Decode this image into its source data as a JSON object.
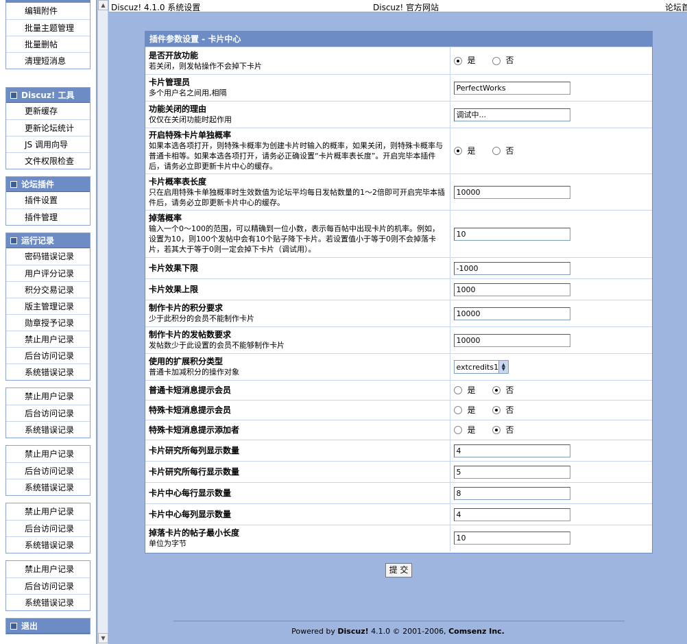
{
  "topbar": {
    "left": "Discuz! 4.1.0 系统设置",
    "center": "Discuz! 官方网站",
    "right": "论坛首"
  },
  "sidebar": {
    "group0": {
      "items": [
        "编辑附件",
        "批量主题管理",
        "批量删帖",
        "清理短消息"
      ]
    },
    "group1": {
      "title": "Discuz! 工具",
      "items": [
        "更新缓存",
        "更新论坛统计",
        "JS 调用向导",
        "文件权限检查"
      ]
    },
    "group2": {
      "title": "论坛插件",
      "items": [
        "插件设置",
        "插件管理"
      ]
    },
    "group3": {
      "title": "运行记录",
      "items": [
        "密码错误记录",
        "用户评分记录",
        "积分交易记录",
        "版主管理记录",
        "勋章授予记录",
        "禁止用户记录",
        "后台访问记录",
        "系统错误记录"
      ]
    },
    "group4": {
      "items": [
        "禁止用户记录",
        "后台访问记录",
        "系统错误记录"
      ]
    },
    "group5": {
      "items": [
        "禁止用户记录",
        "后台访问记录",
        "系统错误记录"
      ]
    },
    "group6": {
      "items": [
        "禁止用户记录",
        "后台访问记录",
        "系统错误记录"
      ]
    },
    "group7": {
      "items": [
        "禁止用户记录",
        "后台访问记录",
        "系统错误记录"
      ]
    },
    "group8": {
      "title": "退出"
    }
  },
  "panel": {
    "title": "插件参数设置 - 卡片中心",
    "yes": "是",
    "no": "否",
    "rows": [
      {
        "title": "是否开放功能",
        "desc": "若关闭，则发帖操作不会掉下卡片"
      },
      {
        "title": "卡片管理员",
        "desc": "多个用户名之间用,相隔",
        "value": "PerfectWorks"
      },
      {
        "title": "功能关闭的理由",
        "desc": "仅仅在关闭功能时起作用",
        "value": "调试中..."
      },
      {
        "title": "开启特殊卡片单独概率",
        "desc": "如果本选各项打开，则特殊卡概率为创建卡片时输入的概率，如果关闭，则特殊卡概率与普通卡相等。如果本选各项打开，请务必正确设置“卡片概率表长度”。开启完毕本插件后，请务必立即更新卡片中心的缓存。"
      },
      {
        "title": "卡片概率表长度",
        "desc": "只在启用特殊卡单独概率时生效数值为论坛平均每日发帖数量的1～2倍即可开启完毕本插件后，请务必立即更新卡片中心的缓存。",
        "value": "10000"
      },
      {
        "title": "掉落概率",
        "desc": "输入一个0～100的范围，可以精确到一位小数，表示每百帖中出现卡片的机率。例如，设置为10，则100个发帖中会有10个贴子降下卡片。若设置值小于等于0则不会掉落卡片，若其大于等于0则一定会掉下卡片（调试用）。",
        "value": "10"
      },
      {
        "title": "卡片效果下限",
        "desc": "",
        "value": "-1000"
      },
      {
        "title": "卡片效果上限",
        "desc": "",
        "value": "1000"
      },
      {
        "title": "制作卡片的积分要求",
        "desc": "少于此积分的会员不能制作卡片",
        "value": "10000"
      },
      {
        "title": "制作卡片的发帖数要求",
        "desc": "发帖数少于此设置的会员不能够制作卡片",
        "value": "10000"
      },
      {
        "title": "使用的扩展积分类型",
        "desc": "普通卡加减积分的操作对象",
        "value": "extcredits1"
      },
      {
        "title": "普通卡短消息提示会员",
        "desc": ""
      },
      {
        "title": "特殊卡短消息提示会员",
        "desc": ""
      },
      {
        "title": "特殊卡短消息提示添加者",
        "desc": ""
      },
      {
        "title": "卡片研究所每列显示数量",
        "desc": "",
        "value": "4"
      },
      {
        "title": "卡片研究所每行显示数量",
        "desc": "",
        "value": "5"
      },
      {
        "title": "卡片中心每行显示数量",
        "desc": "",
        "value": "8"
      },
      {
        "title": "卡片中心每列显示数量",
        "desc": "",
        "value": "4"
      },
      {
        "title": "掉落卡片的帖子最小长度",
        "desc": "单位为字节",
        "value": "10"
      }
    ]
  },
  "submit_label": "提 交",
  "footer": {
    "prefix": "Powered by ",
    "brand": "Discuz!",
    "version": " 4.1.0  © 2001-2006, ",
    "company": "Comsenz Inc."
  }
}
